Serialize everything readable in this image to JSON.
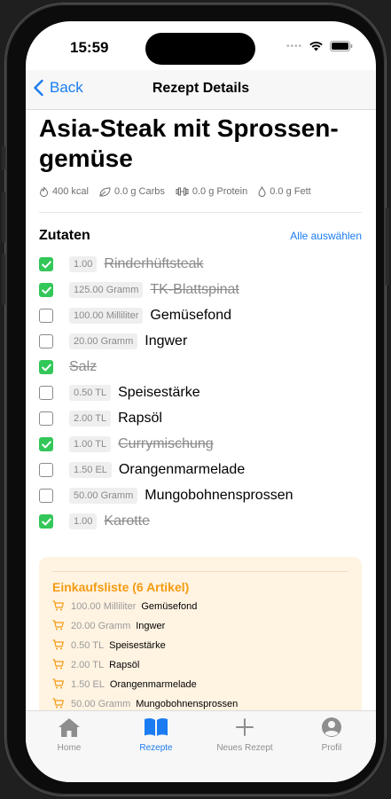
{
  "status": {
    "time": "15:59"
  },
  "nav": {
    "back_label": "Back",
    "title": "Rezept Details"
  },
  "recipe": {
    "title": "Asia-Steak mit Sprossen-gemüse",
    "nutrition": {
      "kcal": "400 kcal",
      "carbs": "0.0 g Carbs",
      "protein": "0.0 g Protein",
      "fat": "0.0 g Fett"
    }
  },
  "ingredients": {
    "heading": "Zutaten",
    "select_all": "Alle auswählen",
    "items": [
      {
        "qty": "1.00",
        "name": "Rinderhüftsteak",
        "checked": true
      },
      {
        "qty": "125.00 Gramm",
        "name": "TK-Blattspinat",
        "checked": true
      },
      {
        "qty": "100.00 Milliliter",
        "name": "Gemüsefond",
        "checked": false
      },
      {
        "qty": "20.00 Gramm",
        "name": "Ingwer",
        "checked": false
      },
      {
        "qty": "",
        "name": "Salz",
        "checked": true
      },
      {
        "qty": "0.50 TL",
        "name": "Speisestärke",
        "checked": false
      },
      {
        "qty": "2.00 TL",
        "name": "Rapsöl",
        "checked": false
      },
      {
        "qty": "1.00 TL",
        "name": "Currymischung",
        "checked": true
      },
      {
        "qty": "1.50 EL",
        "name": "Orangenmarmelade",
        "checked": false
      },
      {
        "qty": "50.00 Gramm",
        "name": "Mungobohnensprossen",
        "checked": false
      },
      {
        "qty": "1.00",
        "name": "Karotte",
        "checked": true
      }
    ]
  },
  "shopping": {
    "title": "Einkaufsliste (6 Artikel)",
    "items": [
      {
        "qty": "100.00 Milliliter",
        "name": "Gemüsefond"
      },
      {
        "qty": "20.00 Gramm",
        "name": "Ingwer"
      },
      {
        "qty": "0.50 TL",
        "name": "Speisestärke"
      },
      {
        "qty": "2.00 TL",
        "name": "Rapsöl"
      },
      {
        "qty": "1.50 EL",
        "name": "Orangenmarmelade"
      },
      {
        "qty": "50.00 Gramm",
        "name": "Mungobohnensprossen"
      }
    ]
  },
  "tabs": [
    {
      "label": "Home",
      "icon": "house-icon",
      "active": false
    },
    {
      "label": "Rezepte",
      "icon": "book-icon",
      "active": true
    },
    {
      "label": "Neues Rezept",
      "icon": "plus-icon",
      "active": false
    },
    {
      "label": "Profil",
      "icon": "person-circle-icon",
      "active": false
    }
  ],
  "colors": {
    "accent": "#1a7cf0",
    "checked": "#33c759",
    "shopping_accent": "#f39c12",
    "shopping_bg": "#fff3e2"
  }
}
